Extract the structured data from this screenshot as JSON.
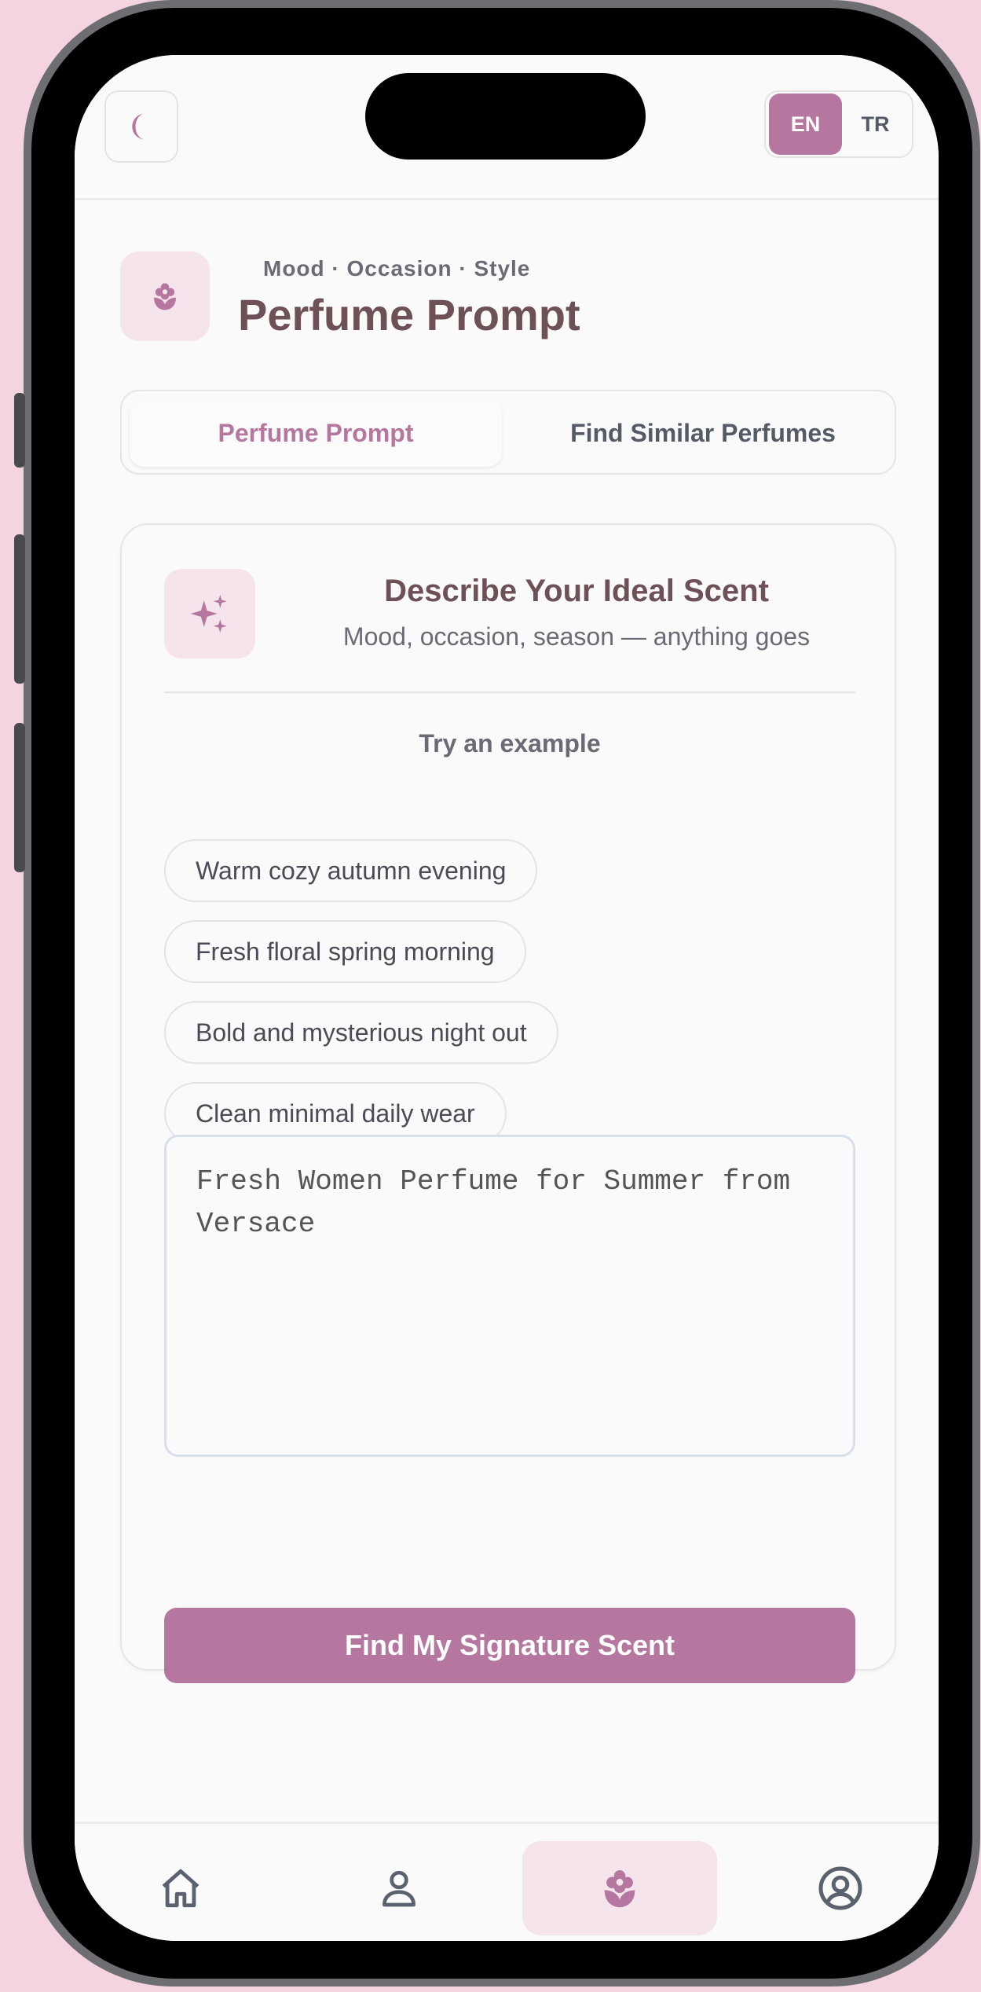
{
  "topbar": {
    "theme_icon": "moon-icon",
    "languages": [
      {
        "label": "EN",
        "active": true
      },
      {
        "label": "TR",
        "active": false
      }
    ]
  },
  "header": {
    "icon": "flower-icon",
    "subtitle": "Mood · Occasion · Style",
    "title": "Perfume Prompt"
  },
  "tabs": [
    {
      "label": "Perfume Prompt",
      "active": true
    },
    {
      "label": "Find Similar Perfumes",
      "active": false
    }
  ],
  "card": {
    "icon": "sparkles-icon",
    "title": "Describe Your Ideal Scent",
    "subtitle": "Mood, occasion, season — anything goes",
    "examples_label": "Try an example",
    "examples": [
      "Warm cozy autumn evening",
      "Fresh floral spring morning",
      "Bold and mysterious night out",
      "Clean minimal daily wear"
    ],
    "prompt_value": "Fresh Women Perfume for Summer from Versace",
    "submit_label": "Find My Signature Scent"
  },
  "bottom_nav": [
    {
      "icon": "home-icon",
      "active": false
    },
    {
      "icon": "user-icon",
      "active": false
    },
    {
      "icon": "flower-icon",
      "active": true
    },
    {
      "icon": "profile-circle-icon",
      "active": false
    }
  ],
  "colors": {
    "accent": "#b5779f",
    "accent_light": "#f5e4ec",
    "title": "#6e5156",
    "background": "#f3d4e0"
  }
}
